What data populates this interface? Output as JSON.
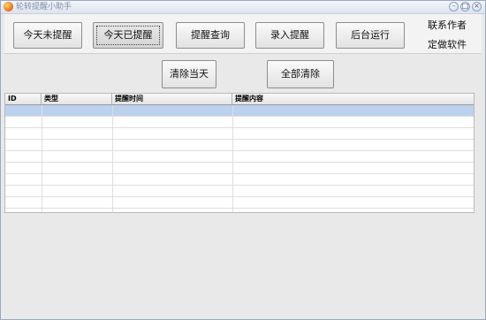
{
  "window": {
    "title": "轮转提醒小助手",
    "minimize_glyph": "–",
    "maximize_glyph": "□",
    "close_glyph": "×"
  },
  "toolbar": {
    "today_unreminded": "今天未提醒",
    "today_reminded": "今天已提醒",
    "query": "提醒查询",
    "enter": "录入提醒",
    "background_run": "后台运行",
    "contact_author": "联系作者",
    "custom_software": "定做软件"
  },
  "actions": {
    "clear_today": "清除当天",
    "clear_all": "全部清除"
  },
  "table": {
    "columns": [
      "ID",
      "类型",
      "提醒时间",
      "提醒内容"
    ],
    "rows": []
  }
}
